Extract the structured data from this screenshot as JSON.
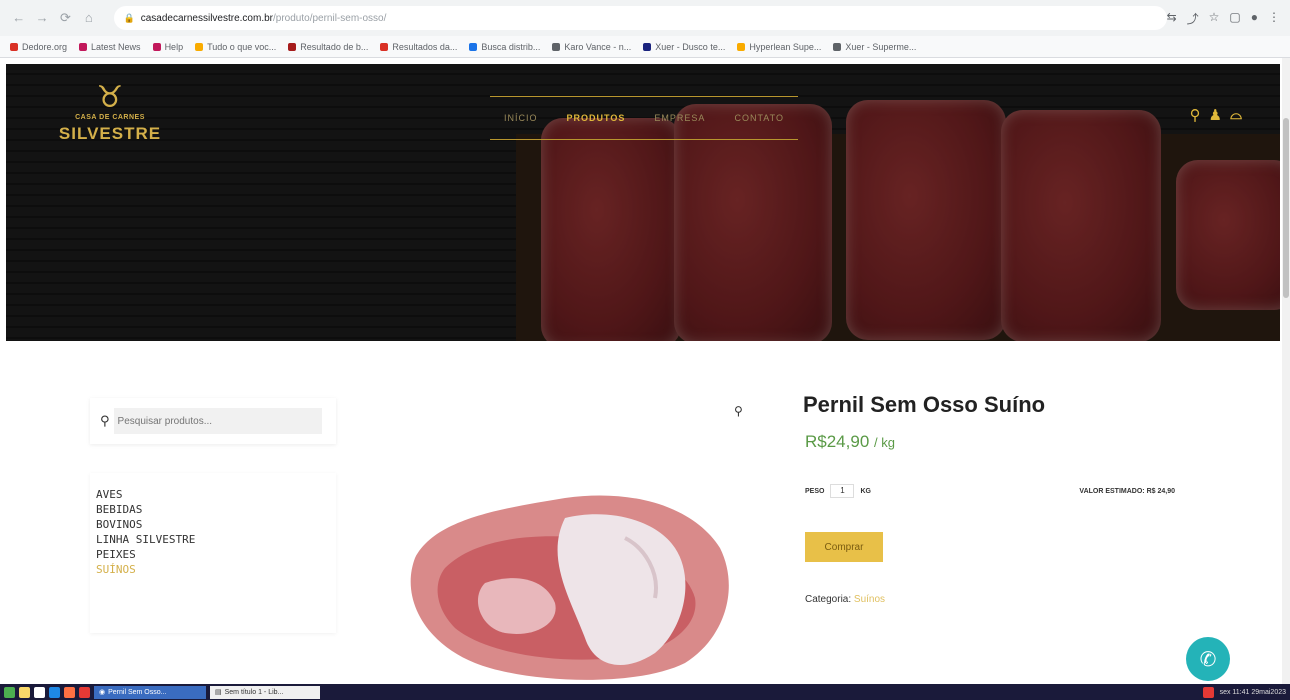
{
  "browser": {
    "url_host": "casadecarnessilvestre.com.br",
    "url_path": "/produto/pernil-sem-osso/",
    "bookmarks": [
      {
        "label": "Dedore.org",
        "color": "#d93025"
      },
      {
        "label": "Latest News",
        "color": "#c2185b"
      },
      {
        "label": "Help",
        "color": "#c2185b"
      },
      {
        "label": "Tudo o que voc...",
        "color": "#f9ab00"
      },
      {
        "label": "Resultado de b...",
        "color": "#a61c1c"
      },
      {
        "label": "Resultados da...",
        "color": "#d93025"
      },
      {
        "label": "Busca distrib...",
        "color": "#1a73e8"
      },
      {
        "label": "Karo Vance - n...",
        "color": "#5f6368"
      },
      {
        "label": "Xuer - Dusco te...",
        "color": "#1a237e"
      },
      {
        "label": "Hyperlean Supe...",
        "color": "#f9ab00"
      },
      {
        "label": "Xuer - Superme...",
        "color": "#5f6368"
      }
    ]
  },
  "site": {
    "logo": {
      "top": "CASA DE CARNES",
      "name": "SILVESTRE"
    },
    "menu": [
      "INÍCIO",
      "PRODUTOS",
      "EMPRESA",
      "CONTATO"
    ],
    "active_menu": "PRODUTOS",
    "accent_color": "#d4b04a"
  },
  "sidebar": {
    "search_placeholder": "Pesquisar produtos...",
    "categories": [
      "AVES",
      "BEBIDAS",
      "BOVINOS",
      "LINHA SILVESTRE",
      "PEIXES",
      "SUÍNOS"
    ],
    "active_category": "SUÍNOS"
  },
  "product": {
    "title": "Pernil Sem Osso Suíno",
    "price": "R$24,90",
    "unit": "/ kg",
    "weight_label": "PESO",
    "weight_value": "1",
    "weight_unit": "KG",
    "estimate_label": "VALOR ESTIMADO:",
    "estimate_value": "R$ 24,90",
    "buy_label": "Comprar",
    "category_label": "Categoria:",
    "category_value": "Suínos"
  },
  "taskbar": {
    "task1": "Pernil Sem Osso...",
    "task2": "Sem título 1 - Lib...",
    "clock": "sex 11:41 29mai2023"
  }
}
